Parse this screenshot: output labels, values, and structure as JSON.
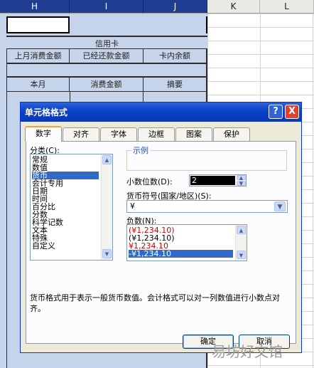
{
  "columns": [
    "H",
    "I",
    "J",
    "K",
    "L"
  ],
  "sheet": {
    "header_merged": "信用卡",
    "row_labels": [
      "上月消费金额",
      "已经还款金额",
      "卡内余额"
    ],
    "row2_labels": [
      "本月",
      "消费金额",
      "摘要"
    ]
  },
  "dialog": {
    "title": "单元格格式",
    "help_button": "?",
    "close_button": "X",
    "tabs": [
      "数字",
      "对齐",
      "字体",
      "边框",
      "图案",
      "保护"
    ],
    "category_label": "分类(C):",
    "categories": [
      "常规",
      "数值",
      "货币",
      "会计专用",
      "日期",
      "时间",
      "百分比",
      "分数",
      "科学记数",
      "文本",
      "特殊",
      "自定义"
    ],
    "selected_category": "货币",
    "sample_label": "示例",
    "decimal_label": "小数位数(D):",
    "decimal_value": "2",
    "symbol_label": "货币符号(国家/地区)(S):",
    "symbol_value": "¥",
    "negative_label": "负数(N):",
    "negative_options": [
      "(¥1,234.10)",
      "(¥1,234.10)",
      "¥1,234.10",
      "-¥1,234.10"
    ],
    "negative_colors": [
      "#cc0000",
      "#000000",
      "#cc0000",
      "#ffffff"
    ],
    "description": "货币格式用于表示一般货币数值。会计格式可以对一列数值进行小数点对齐。",
    "ok_button": "确定",
    "cancel_button": "取消"
  },
  "watermark": "易坊好文馆"
}
